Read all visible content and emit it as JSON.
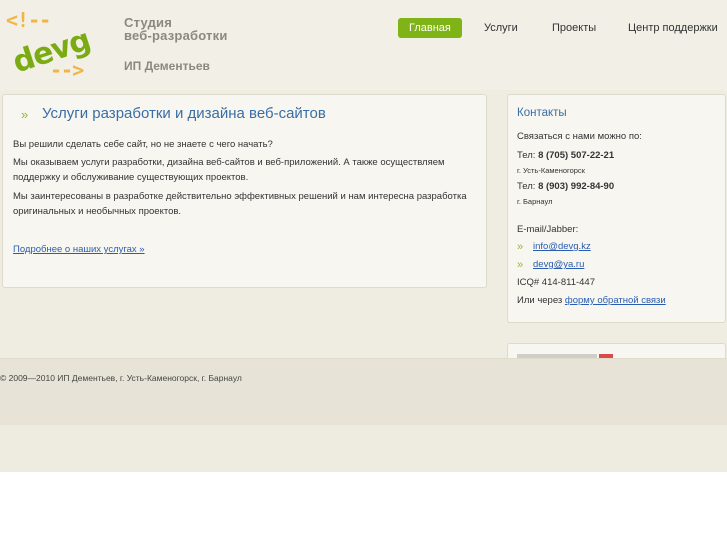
{
  "brand": {
    "logo_bracket_top": "<!--",
    "logo_word": "devg",
    "logo_bracket_bottom": "-->",
    "studio_line1": "Студия",
    "studio_line2": "веб-разработки",
    "owner": "ИП Дементьев"
  },
  "nav": [
    {
      "label": "Главная",
      "active": true
    },
    {
      "label": "Услуги",
      "active": false
    },
    {
      "label": "Проекты",
      "active": false
    },
    {
      "label": "Центр поддержки",
      "active": false
    }
  ],
  "main": {
    "title_mark": "»",
    "title": "Услуги разработки и дизайна веб-сайтов",
    "p1": "Вы решили сделать себе сайт, но не знаете с чего начать?",
    "p2_line1": "Мы оказываем услуги разработки, дизайна веб-сайтов и веб-приложений. А также осуществляем",
    "p2_line2": "поддержку и обслуживание существующих проектов.",
    "p3_line1": "Мы заинтересованы в разработке действительно эффективных решений и нам интересна разработка",
    "p3_line2": "оригинальных и необычных проектов.",
    "more_link": "Подробнее о наших услугах »"
  },
  "contacts": {
    "title": "Контакты",
    "intro": "Связаться с нами можно по:",
    "phone1_label": "Тел:",
    "phone1": "8 (705) 507-22-21",
    "city1": "г. Усть-Каменогорск",
    "phone2_label": "Тел:",
    "phone2": "8 (903) 992-84-90",
    "city2": "г. Барнаул",
    "email_label": "E-mail/Jabber:",
    "bullet": "»",
    "email1": "info@devg.kz",
    "email2": "devg@ya.ru",
    "icq": "ICQ# 414-811-447",
    "or_via": "Или через",
    "feedback_link": "форму обратной связи"
  },
  "footer": {
    "copyright": "© 2009—2010 ИП Дементьев, г. Усть-Каменогорск, г. Барнаул"
  },
  "colors": {
    "accent_green": "#7fb416",
    "title_blue": "#3a6ea5",
    "link_blue": "#2a5db0",
    "logo_orange": "#f2b544"
  }
}
